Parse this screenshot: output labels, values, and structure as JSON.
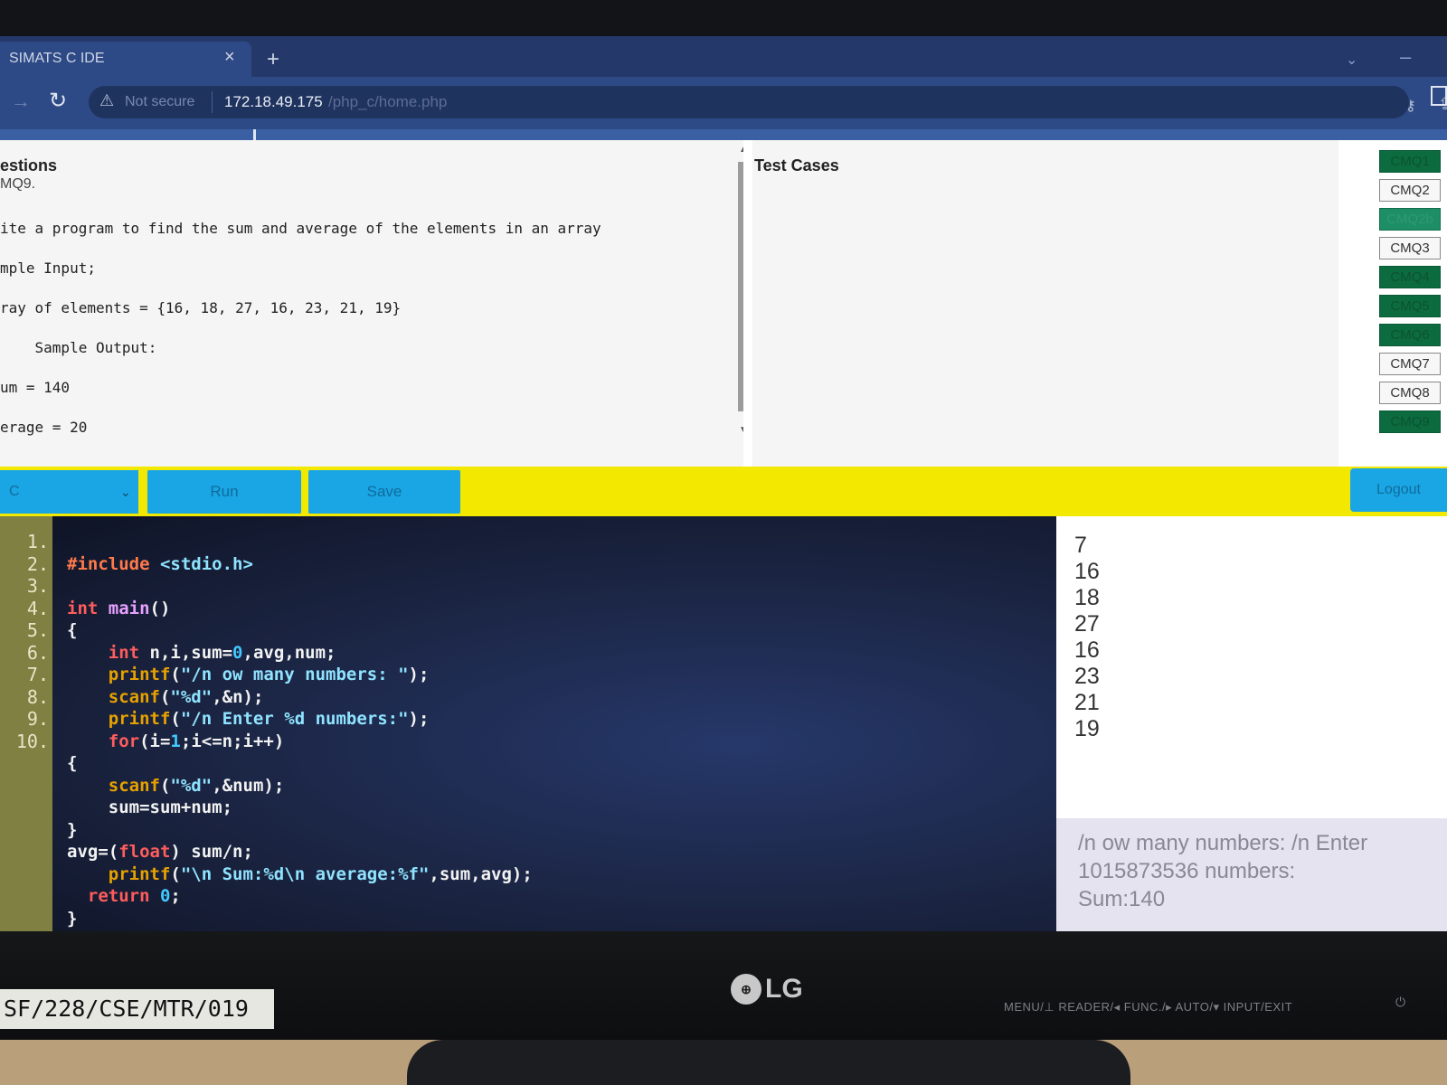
{
  "browser": {
    "tab_title": "SIMATS C IDE",
    "close_label": "×",
    "new_tab_label": "+",
    "not_secure": "Not secure",
    "url_host": "172.18.49.175",
    "url_path": "/php_c/home.php"
  },
  "questions": {
    "title": "estions",
    "id": "MQ9.",
    "lines": [
      "ite a program to find the sum and average of the elements in an array",
      "mple Input;",
      "ray of elements = {16, 18, 27, 16, 23, 21, 19}",
      "    Sample Output:",
      "um = 140",
      "erage = 20"
    ]
  },
  "testcases": {
    "title": "Test Cases"
  },
  "cmq_buttons": [
    {
      "label": "CMQ1",
      "state": "done"
    },
    {
      "label": "CMQ2",
      "state": "pending"
    },
    {
      "label": "CMQ2b",
      "state": "done-light"
    },
    {
      "label": "CMQ3",
      "state": "pending"
    },
    {
      "label": "CMQ4",
      "state": "done"
    },
    {
      "label": "CMQ5",
      "state": "done"
    },
    {
      "label": "CMQ6",
      "state": "done"
    },
    {
      "label": "CMQ7",
      "state": "pending"
    },
    {
      "label": "CMQ8",
      "state": "pending"
    },
    {
      "label": "CMQ9",
      "state": "done"
    }
  ],
  "toolbar": {
    "language": "C",
    "run_label": "Run",
    "save_label": "Save",
    "logout_label": "Logout"
  },
  "editor": {
    "line_numbers": [
      "1.",
      "2.",
      "3.",
      "4.",
      "5.",
      "6.",
      "7.",
      "8.",
      "9.",
      "10."
    ]
  },
  "input_values": [
    "7",
    "16",
    "18",
    "27",
    "16",
    "23",
    "21",
    "19"
  ],
  "output_lines": [
    "/n ow many numbers: /n Enter",
    "1015873536 numbers:",
    "Sum:140"
  ],
  "monitor": {
    "asset_tag": "SF/228/CSE/MTR/019",
    "brand": "LG",
    "controls": "MENU/⊥  READER/◂  FUNC./▸  AUTO/▾  INPUT/EXIT"
  },
  "colors": {
    "toolbar": "#f2e800",
    "button": "#1aa5e4",
    "done": "#0c6b3f",
    "browser": "#2e4a86"
  }
}
